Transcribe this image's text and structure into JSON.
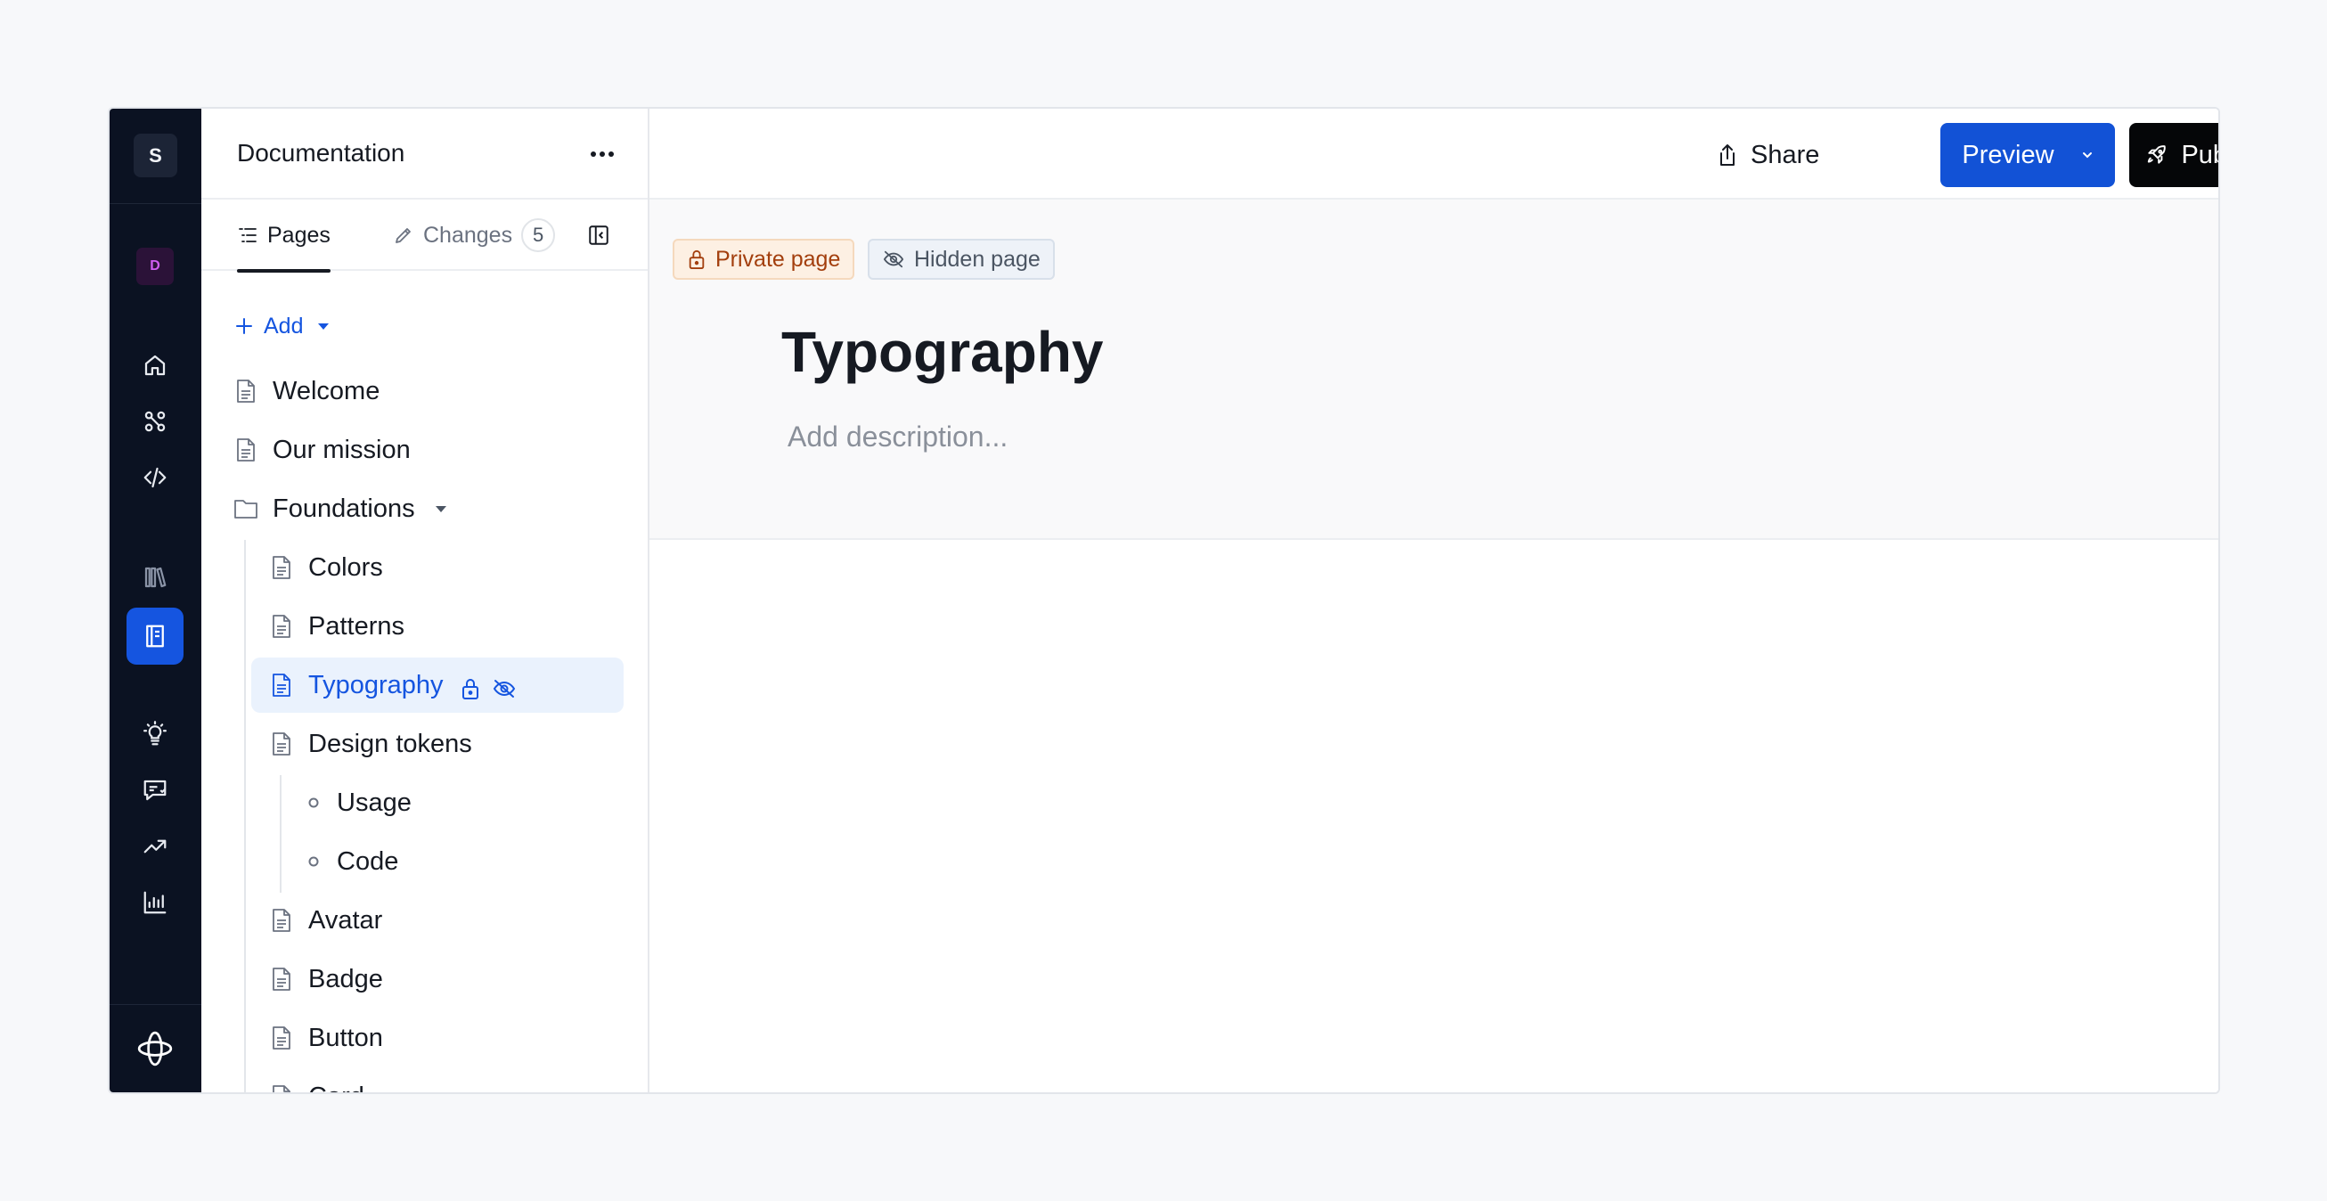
{
  "rail": {
    "workspace_initial": "S",
    "design_system_initial": "D",
    "icons": [
      "home-icon",
      "components-icon",
      "code-icon",
      "library-icon",
      "documentation-icon",
      "insights-icon",
      "feedback-icon",
      "trending-icon",
      "analytics-icon",
      "brand-logo-icon"
    ],
    "active": "documentation-icon"
  },
  "sidebar": {
    "title": "Documentation",
    "tabs": {
      "pages": "Pages",
      "changes": "Changes",
      "changes_count": "5"
    },
    "add_label": "Add",
    "tree": [
      {
        "label": "Welcome",
        "type": "page"
      },
      {
        "label": "Our mission",
        "type": "page"
      },
      {
        "label": "Foundations",
        "type": "folder",
        "expanded": true
      },
      {
        "label": "Colors",
        "type": "page"
      },
      {
        "label": "Patterns",
        "type": "page"
      },
      {
        "label": "Typography",
        "type": "page",
        "selected": true,
        "private": true,
        "hidden": true
      },
      {
        "label": "Design tokens",
        "type": "page"
      },
      {
        "label": "Usage",
        "type": "subpage"
      },
      {
        "label": "Code",
        "type": "subpage"
      },
      {
        "label": "Avatar",
        "type": "page"
      },
      {
        "label": "Badge",
        "type": "page"
      },
      {
        "label": "Button",
        "type": "page"
      },
      {
        "label": "Card",
        "type": "page"
      }
    ]
  },
  "topbar": {
    "share_label": "Share",
    "preview_label": "Preview",
    "publish_label": "Publish"
  },
  "page": {
    "private_label": "Private page",
    "hidden_label": "Hidden page",
    "title": "Typography",
    "description_placeholder": "Add description..."
  },
  "colors": {
    "accent": "#1555e0",
    "rail_bg": "#0b1222",
    "publish_bg": "#050608",
    "private_text": "#a33f0e"
  }
}
